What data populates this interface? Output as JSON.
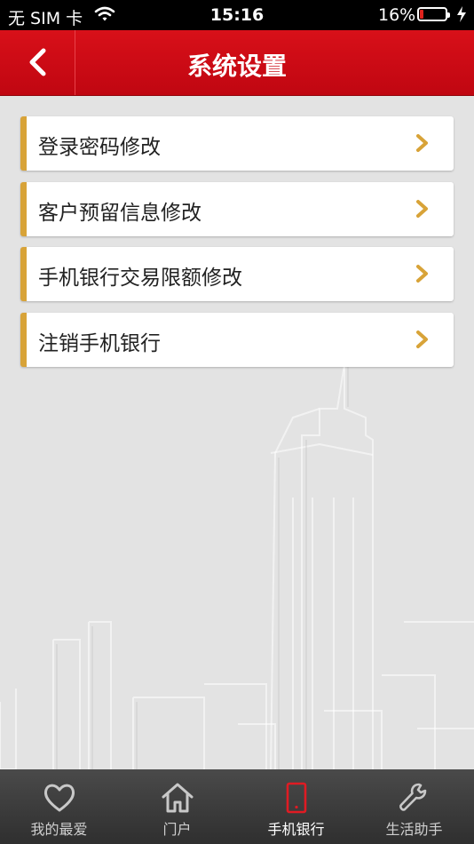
{
  "status_bar": {
    "carrier": "无 SIM 卡",
    "time": "15:16",
    "battery_percent": "16%",
    "battery_level": 0.16,
    "battery_color": "#e0231d"
  },
  "nav_bar": {
    "title": "系统设置",
    "back_icon": "chevron-left-icon",
    "color": "#cc0a14"
  },
  "menu": {
    "accent_color": "#d8a338",
    "items": [
      {
        "label": "登录密码修改",
        "icon": "chevron-right-icon"
      },
      {
        "label": "客户预留信息修改",
        "icon": "chevron-right-icon"
      },
      {
        "label": "手机银行交易限额修改",
        "icon": "chevron-right-icon"
      },
      {
        "label": "注销手机银行",
        "icon": "chevron-right-icon"
      }
    ]
  },
  "tab_bar": {
    "active_color": "#e01b23",
    "tabs": [
      {
        "label": "我的最爱",
        "icon": "heart-icon",
        "active": false
      },
      {
        "label": "门户",
        "icon": "home-icon",
        "active": false
      },
      {
        "label": "手机银行",
        "icon": "mobile-phone-icon",
        "active": true
      },
      {
        "label": "生活助手",
        "icon": "wrench-icon",
        "active": false
      }
    ]
  }
}
